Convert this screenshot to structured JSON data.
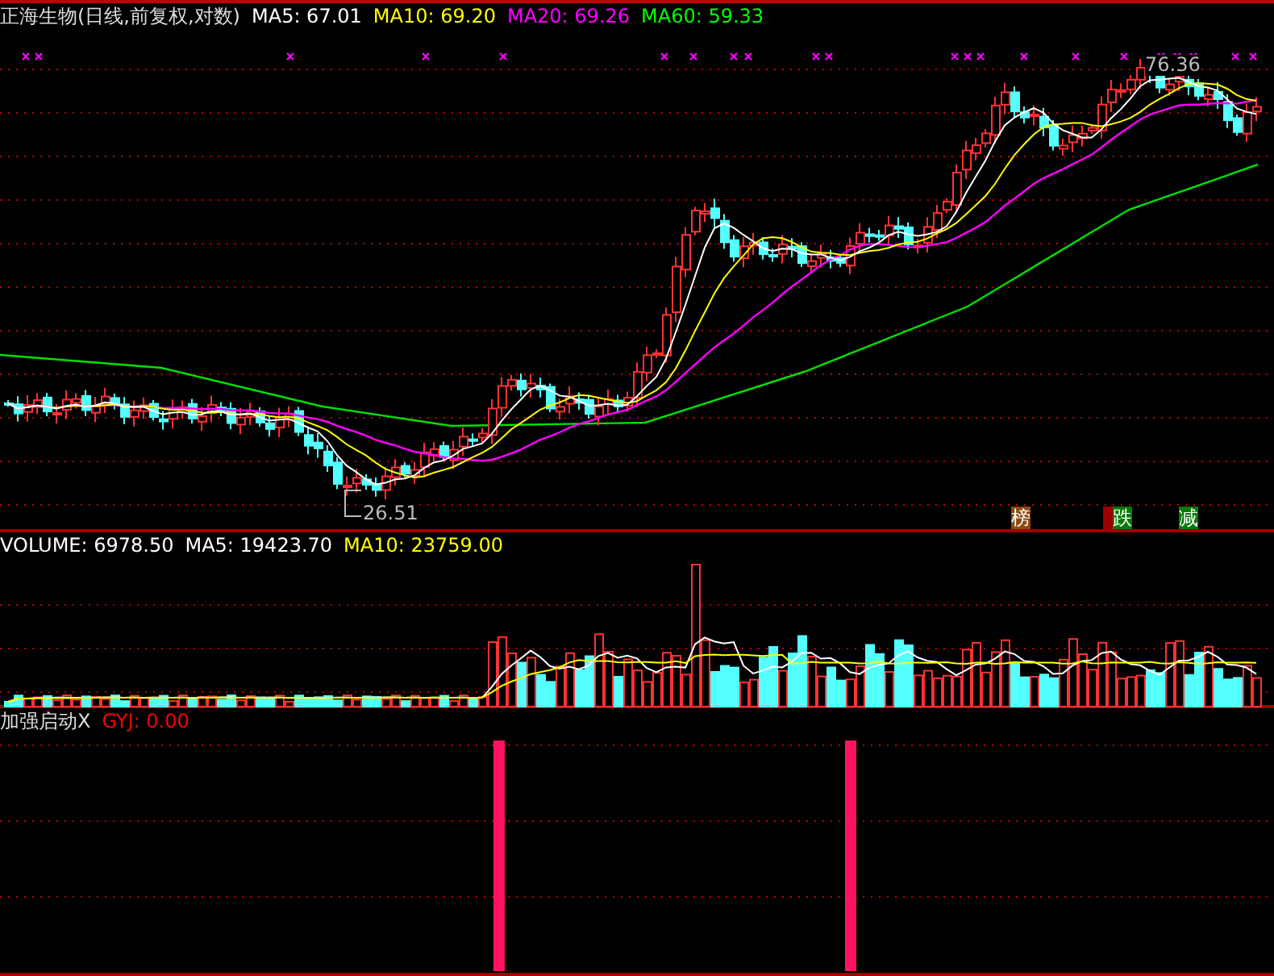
{
  "main": {
    "title": "正海生物(日线,前复权,对数)",
    "ma": [
      {
        "label": "MA5: 67.01",
        "color": "#ffffff"
      },
      {
        "label": "MA10: 69.20",
        "color": "#ffff00"
      },
      {
        "label": "MA20: 69.26",
        "color": "#ff00ff"
      },
      {
        "label": "MA60: 59.33",
        "color": "#00ff00"
      }
    ],
    "price_labels": [
      {
        "kind": "high",
        "text": "76.36"
      },
      {
        "kind": "low",
        "text": "26.51"
      }
    ],
    "signals": [
      {
        "text": "榜",
        "color": "#8b4a10"
      },
      {
        "color": "#a00000"
      },
      {
        "text": "跌",
        "color": "#087a08"
      },
      {
        "text": "减",
        "color": "#087a08"
      }
    ]
  },
  "volume": {
    "labels": [
      {
        "label": "VOLUME: 6978.50",
        "color": "#ffffff"
      },
      {
        "label": "MA5: 19423.70",
        "color": "#ffffff"
      },
      {
        "label": "MA10: 23759.00",
        "color": "#ffff00"
      }
    ]
  },
  "indicator": {
    "name": "加强启动X",
    "labels": [
      {
        "label": "GYJ: 0.00",
        "color": "#ff0000"
      }
    ]
  }
}
